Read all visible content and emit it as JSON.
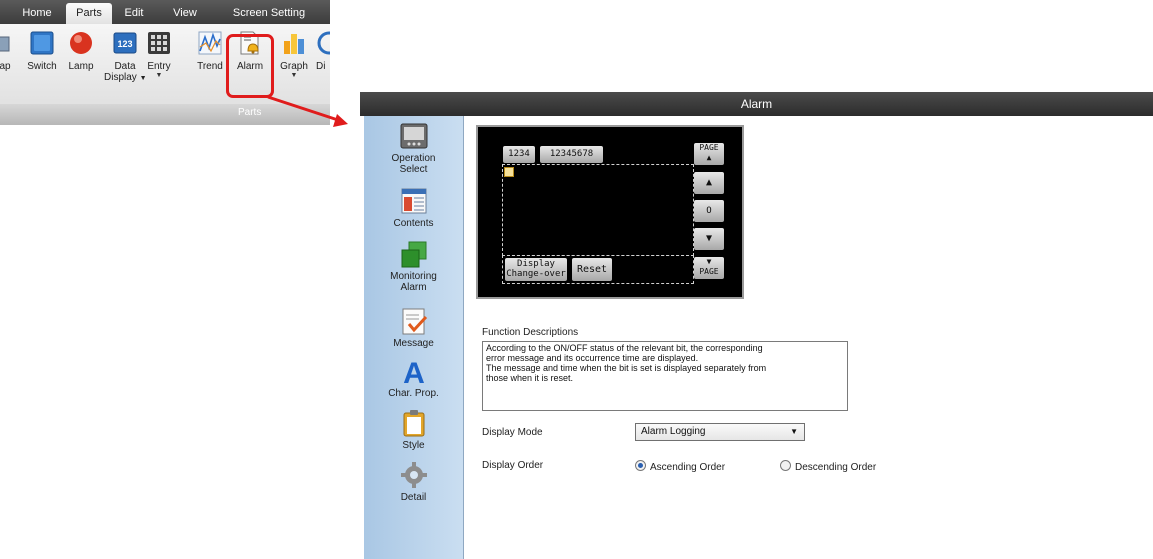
{
  "ribbon": {
    "tabs": [
      "Home",
      "Parts",
      "Edit",
      "View",
      "Screen Setting"
    ],
    "active_tab": "Parts",
    "buttons": [
      {
        "label": "ap",
        "icon": "partial-icon"
      },
      {
        "label": "Switch",
        "icon": "switch-icon"
      },
      {
        "label": "Lamp",
        "icon": "lamp-icon"
      },
      {
        "label": "Data",
        "label2": "Display",
        "icon": "data-display-icon",
        "text": "123"
      },
      {
        "label": "Entry",
        "icon": "entry-icon"
      },
      {
        "label": "Trend",
        "icon": "trend-icon"
      },
      {
        "label": "Alarm",
        "icon": "alarm-icon"
      },
      {
        "label": "Graph",
        "icon": "graph-icon"
      },
      {
        "label": "Di",
        "icon": "partial-icon"
      }
    ],
    "group_label": "Parts",
    "highlight_color": "#e01c1c"
  },
  "dialog": {
    "title": "Alarm",
    "sidebar": [
      {
        "label": "Operation",
        "label2": "Select",
        "icon": "operation-select-icon"
      },
      {
        "label": "Contents",
        "label2": "",
        "icon": "contents-icon"
      },
      {
        "label": "Monitoring",
        "label2": "Alarm",
        "icon": "monitoring-alarm-icon"
      },
      {
        "label": "Message",
        "label2": "",
        "icon": "message-icon"
      },
      {
        "label": "Char. Prop.",
        "label2": "",
        "icon": "char-prop-icon"
      },
      {
        "label": "Style",
        "label2": "",
        "icon": "style-icon"
      },
      {
        "label": "Detail",
        "label2": "",
        "icon": "detail-icon"
      }
    ],
    "preview": {
      "tab1": "1234",
      "tab2": "12345678",
      "page_up": "PAGE",
      "page_down": "PAGE",
      "center_btn": "O",
      "display_btn_line1": "Display",
      "display_btn_line2": "Change-over",
      "reset_btn": "Reset"
    },
    "function_descriptions": {
      "label": "Function Descriptions",
      "text1": "According to the ON/OFF status of the relevant bit, the corresponding",
      "text2": "error message and its occurrence time are displayed.",
      "text3": "The message and time when the bit is set is displayed separately from",
      "text4": "those when it is reset."
    },
    "display_mode": {
      "label": "Display Mode",
      "value": "Alarm Logging"
    },
    "display_order": {
      "label": "Display Order",
      "options": [
        "Ascending Order",
        "Descending Order"
      ],
      "selected": "Ascending Order"
    }
  }
}
